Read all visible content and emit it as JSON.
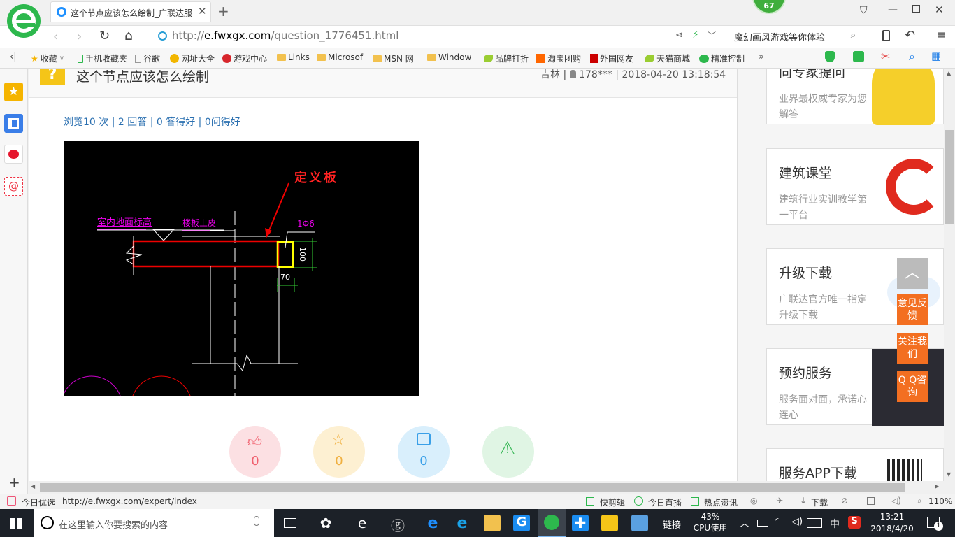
{
  "browser": {
    "tab_title": "这个节点应该怎么绘制_广联达服",
    "url": "http://e.fwxgx.com/question_1776451.html",
    "url_plain": "http://",
    "url_domain": "e.fwxgx.com",
    "url_path": "/question_1776451.html",
    "search_placeholder": "魔幻画风游戏等你体验",
    "badge_count": "67"
  },
  "favorites": [
    {
      "label": "收藏"
    },
    {
      "label": "手机收藏夹"
    },
    {
      "label": "谷歌"
    },
    {
      "label": "网址大全"
    },
    {
      "label": "游戏中心"
    },
    {
      "label": "Links"
    },
    {
      "label": "Microsof"
    },
    {
      "label": "MSN 网"
    },
    {
      "label": "Window"
    },
    {
      "label": "品牌打折"
    },
    {
      "label": "淘宝团购"
    },
    {
      "label": "外国网友"
    },
    {
      "label": "天猫商城"
    },
    {
      "label": "精准控制"
    }
  ],
  "question": {
    "title": "这个节点应该怎么绘制",
    "region": "吉林",
    "user": "178***",
    "datetime": "2018-04-20 13:18:54",
    "stats_line": "浏览10 次 | 2 回答 | 0 答得好 | 0问得好"
  },
  "drawing": {
    "label_define": "定义板",
    "label_floor": "室内地面标高",
    "label_stair": "楼板上皮",
    "label_rebar": "1Φ6",
    "label_100": "100",
    "label_70": "70"
  },
  "actions": [
    {
      "name": "like",
      "count": "0",
      "color": "#fce0e3",
      "icon_color": "#f0606e"
    },
    {
      "name": "favorite",
      "count": "0",
      "color": "#fdf0d2",
      "icon_color": "#f0b040"
    },
    {
      "name": "share",
      "count": "0",
      "color": "#d9effc",
      "icon_color": "#3aa0e8"
    },
    {
      "name": "report",
      "count": "",
      "color": "#e0f5e4",
      "icon_color": "#3cb95a"
    }
  ],
  "right_cards": [
    {
      "title": "向专家提问",
      "desc": "业界最权威专家为您解答"
    },
    {
      "title": "建筑课堂",
      "desc": "建筑行业实训教学第一平台"
    },
    {
      "title": "升级下载",
      "desc": "广联达官方唯一指定升级下载"
    },
    {
      "title": "预约服务",
      "desc": "服务面对面，承诺心连心"
    },
    {
      "title": "服务APP下载",
      "desc": ""
    }
  ],
  "float_buttons": {
    "feedback": "意见反馈",
    "follow": "关注我们",
    "qq": "Q Q咨询"
  },
  "status": {
    "today": "今日优选",
    "link_url": "http://e.fwxgx.com/expert/index",
    "kuaijian": "快剪辑",
    "live": "今日直播",
    "news": "热点资讯",
    "download": "下载",
    "zoom": "110%"
  },
  "taskbar": {
    "search_placeholder": "在这里输入你要搜索的内容",
    "links": "链接",
    "cpu_pct": "43%",
    "cpu_label": "CPU使用",
    "ime": "中",
    "time": "13:21",
    "date": "2018/4/20",
    "notif": "1"
  }
}
